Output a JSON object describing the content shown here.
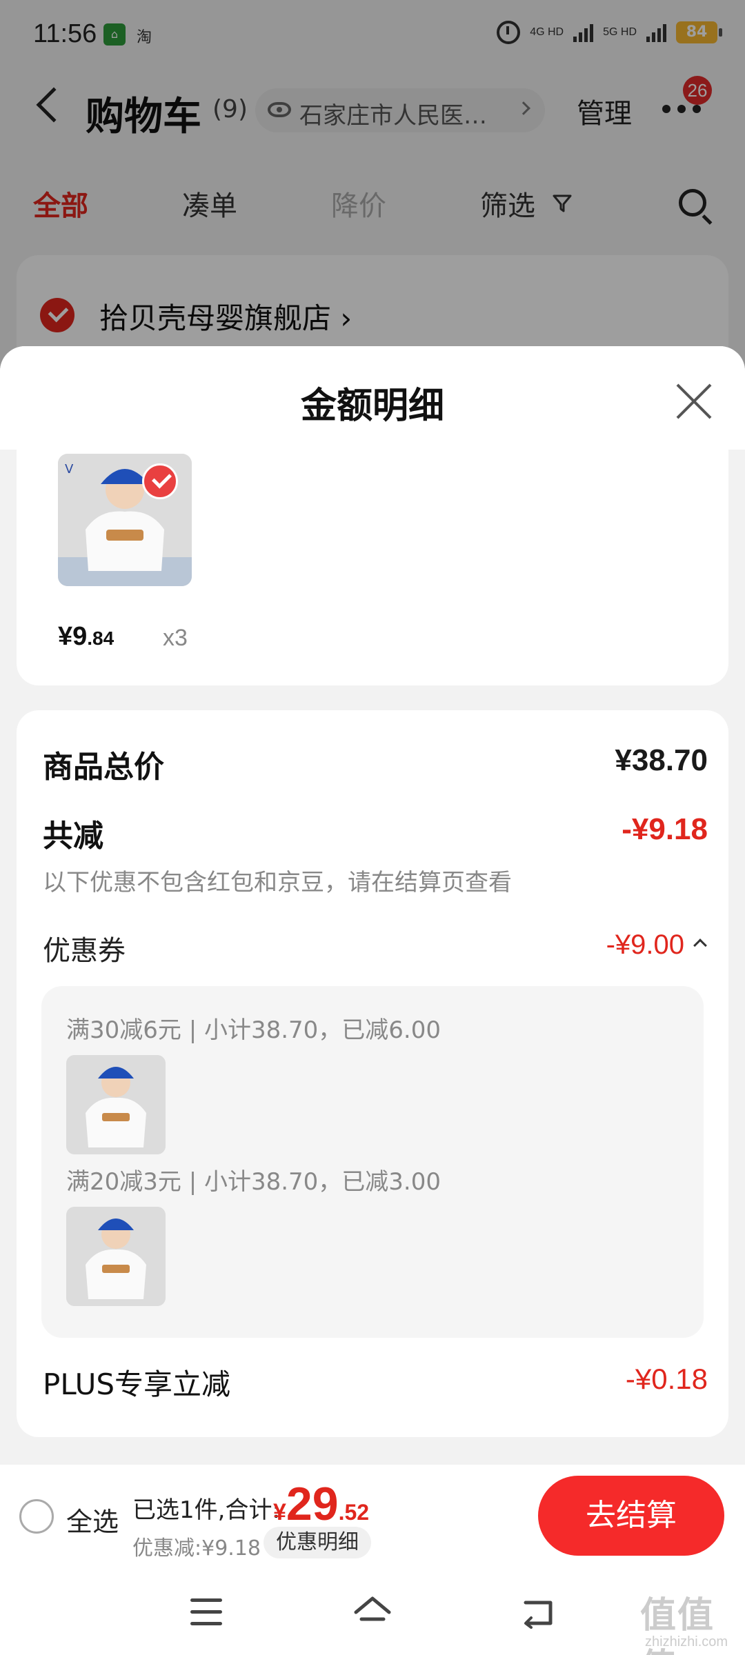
{
  "status_bar": {
    "time": "11:56",
    "app_icon_label": "淘",
    "network_1": "4G HD",
    "network_2": "5G HD",
    "battery": "84"
  },
  "nav": {
    "title": "购物车",
    "count": "(9)",
    "location": "石家庄市人民医…",
    "manage_label": "管理",
    "badge_count": "26"
  },
  "tabs": [
    {
      "label": "全部",
      "state": "active"
    },
    {
      "label": "凑单",
      "state": "normal"
    },
    {
      "label": "降价",
      "state": "disabled"
    },
    {
      "label": "筛选",
      "state": "normal"
    }
  ],
  "store": {
    "name": "拾贝壳母婴旗舰店 ›"
  },
  "sheet": {
    "title": "金额明细"
  },
  "product": {
    "price_int": "¥9",
    "price_dec": ".84",
    "quantity": "x3"
  },
  "summary": {
    "total_label": "商品总价",
    "total_value": "¥38.70",
    "reduce_label": "共减",
    "reduce_value": "-¥9.18",
    "note": "以下优惠不包含红包和京豆，请在结算页查看",
    "coupon_label": "优惠券",
    "coupon_value": "-¥9.00",
    "coupons": [
      {
        "text": "满30减6元 | 小计38.70，已减6.00"
      },
      {
        "text": "满20减3元 | 小计38.70，已减3.00"
      }
    ],
    "plus_label": "PLUS专享立减",
    "plus_value": "-¥0.18"
  },
  "checkout": {
    "select_all_label": "全选",
    "selected_text": "已选1件,合计:",
    "total_yen": "¥",
    "total_int": "29",
    "total_dec": ".52",
    "discount_text": "优惠减:¥9.18",
    "detail_button": "优惠明细",
    "checkout_button": "去结算"
  },
  "watermark": {
    "text": "值值值",
    "sub": "zhizhizhi.com"
  },
  "colors": {
    "accent_red": "#e0261d",
    "checkout_red": "#f52a2a",
    "sheet_bg": "#f2f2f2"
  }
}
